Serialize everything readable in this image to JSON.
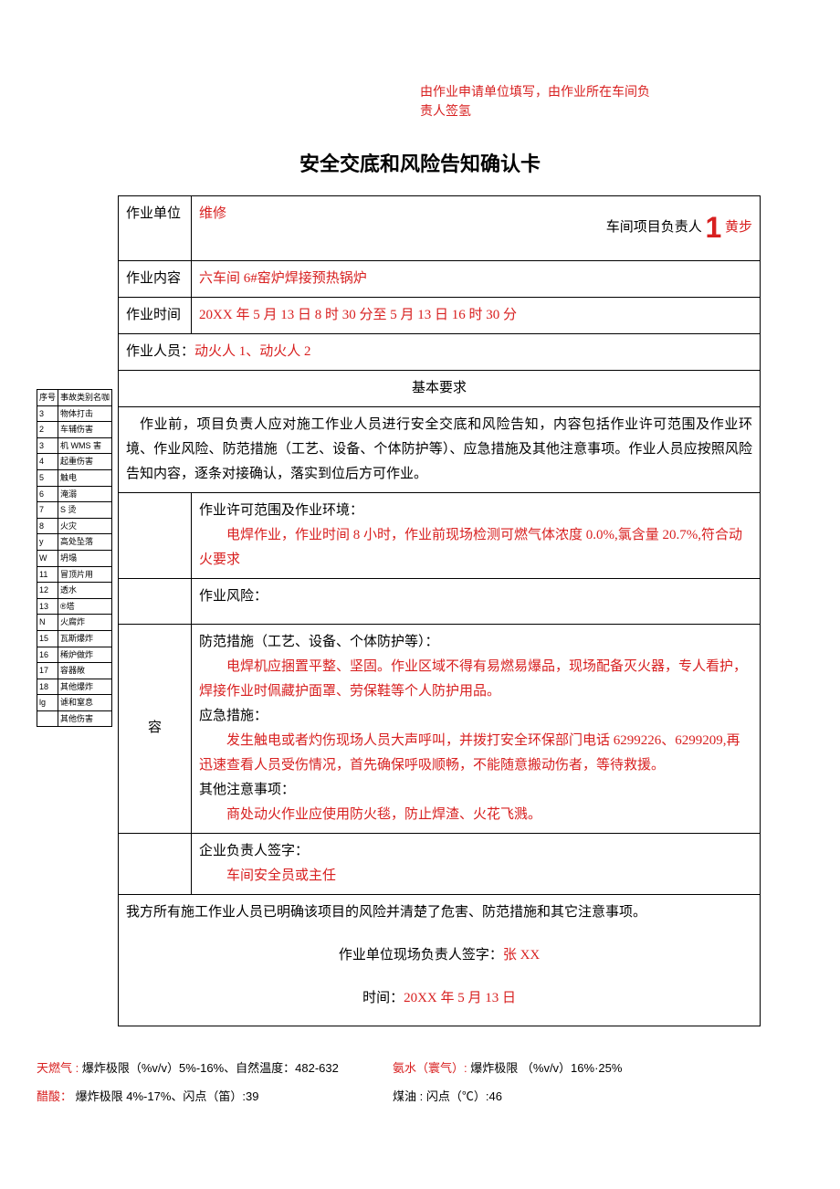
{
  "header_note_l1": "由作业申请单位填写，由作业所在车间负",
  "header_note_l2": "责人签氢",
  "title": "安全交底和风险告知确认卡",
  "labels": {
    "unit": "作业单位",
    "content": "作业内容",
    "time": "作业时间",
    "personnel_prefix": "作业人员：",
    "basic_req": "基本要求",
    "rong": "容"
  },
  "fields": {
    "unit_value": "维修",
    "unit_leader_label": "车间项目负责人",
    "unit_leader_name": "黄步",
    "content_value": "六车间 6#窑炉焊接预热锅炉",
    "time_value": "20XX 年 5 月 13 日 8 时 30 分至 5 月 13 日 16 时 30 分",
    "personnel_value": "动火人 1、动火人 2"
  },
  "basic_req_text": "作业前，项目负责人应对施工作业人员进行安全交底和风险告知，内容包括作业许可范围及作业环境、作业风险、防范措施（工艺、设备、个体防护等）、应急措施及其他注意事项。作业人员应按照风险告知内容，逐条对接确认，落实到位后方可作业。",
  "scope": {
    "label": "作业许可范围及作业环境：",
    "content": "电焊作业，作业时间 8 小时，作业前现场检测可燃气体浓度 0.0%,氯含量 20.7%,符合动火要求"
  },
  "risk_label": "作业风险：",
  "prevent": {
    "label": "防范措施（工艺、设备、个体防护等）：",
    "content": "电焊机应捆置平整、坚固。作业区域不得有易燃易爆品，现场配备灭火器，专人看护，焊接作业时佩藏护面罩、劳保鞋等个人防护用品。"
  },
  "emergency": {
    "label": "应急措施：",
    "content": "发生触电或者灼伤现场人员大声呼叫，并拨打安全环保部门电话 6299226、6299209,再迅速查看人员受伤情况，首先确保呼吸顺畅，不能随意搬动伤者，等待救援。"
  },
  "other": {
    "label": "其他注意事项：",
    "content": "商处动火作业应使用防火毯，防止焊渣、火花飞溅。"
  },
  "sign1": {
    "label": "企业负责人签字：",
    "content": "车间安全员或主任"
  },
  "confirm_text": "我方所有施工作业人员已明确该项目的风险并清楚了危害、防范措施和其它注意事项。",
  "sign2": {
    "label": "作业单位现场负责人签字：",
    "value": "张 XX"
  },
  "sign_time": {
    "label": "时间：",
    "value": "20XX 年 5 月 13 日"
  },
  "side": {
    "h1": "序号",
    "h2": "事故类别名咖",
    "r": [
      [
        "3",
        "物体打击"
      ],
      [
        "2",
        "车辅伤害"
      ],
      [
        "3",
        "机 WMS 害"
      ],
      [
        "4",
        "起重伤害"
      ],
      [
        "5",
        "触电"
      ],
      [
        "6",
        "淹溺"
      ],
      [
        "7",
        "S 烫"
      ],
      [
        "8",
        "火灾"
      ],
      [
        "y",
        "高处坠落"
      ],
      [
        "W",
        "坍塌"
      ],
      [
        "11",
        "冒顶片用"
      ],
      [
        "12",
        "透水"
      ],
      [
        "13",
        "®塔"
      ],
      [
        "N",
        "火腐炸"
      ],
      [
        "15",
        "瓦斯爆炸"
      ],
      [
        "16",
        "稀炉做炸"
      ],
      [
        "17",
        "容器敞"
      ],
      [
        "18",
        "其他爆炸"
      ],
      [
        "lg",
        "谑和窒息"
      ],
      [
        "",
        "其他伤害"
      ]
    ]
  },
  "footer": {
    "l1a_red": "天燃气 :",
    "l1a": "爆炸极限（%v/v）5%-16%、自然温度：482-632",
    "l1b_red": "氨水（寰气）:",
    "l1b_bold": "爆炸极限",
    "l1b": "（%v/v）16%·25%",
    "l2a_red": "醋酸：",
    "l2a": "爆炸极限 4%-17%、闪点（笛）:39",
    "l2b_label": "煤油 :",
    "l2b": "闪点（℃）:46"
  }
}
